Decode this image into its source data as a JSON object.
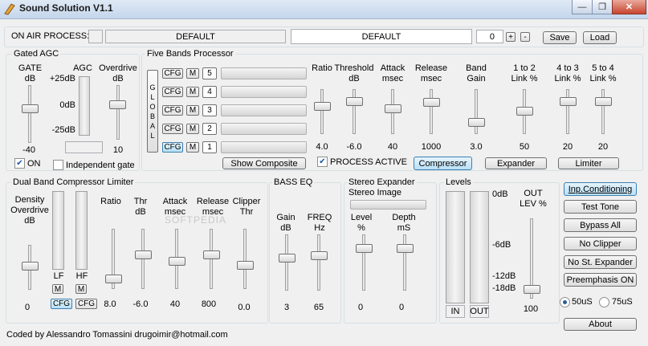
{
  "window": {
    "title": "Sound Solution V1.1",
    "minimize_icon": "—",
    "restore_icon": "❐",
    "close_icon": "✕"
  },
  "onair": {
    "label": "ON AIR PROCESS:",
    "left_preset": "DEFAULT",
    "right_preset": "DEFAULT",
    "preset_number": "0",
    "plus": "+",
    "minus": "-",
    "save": "Save",
    "load": "Load"
  },
  "agc": {
    "title": "Gated AGC",
    "gate_label": "GATE dB",
    "agc_label": "AGC",
    "overdrive_label": "Overdrive\ndB",
    "scale_top": "+25dB",
    "scale_mid": "0dB",
    "scale_bot": "-25dB",
    "gate_value": "-40",
    "overdrive_value": "10",
    "on_label": "ON",
    "on_checked": true,
    "indep_label": "Independent gate",
    "indep_checked": false
  },
  "five": {
    "title": "Five Bands Processor",
    "global": "G\nL\nO\nB\nA\nL",
    "cfg": "CFG",
    "m": "M",
    "bands": [
      "5",
      "4",
      "3",
      "2",
      "1"
    ],
    "cols": [
      {
        "label": "Ratio",
        "value": "4.0"
      },
      {
        "label": "Threshold\ndB",
        "value": "-6.0"
      },
      {
        "label": "Attack\nmsec",
        "value": "40"
      },
      {
        "label": "Release\nmsec",
        "value": "1000"
      },
      {
        "label": "Band\nGain",
        "value": "3.0"
      },
      {
        "label": "1 to 2\nLink %",
        "value": "50"
      },
      {
        "label": "4 to 3\nLink %",
        "value": "20"
      },
      {
        "label": "5 to 4\nLink %",
        "value": "20"
      }
    ],
    "show_composite": "Show Composite",
    "process_active": "PROCESS ACTIVE",
    "process_checked": true,
    "compressor": "Compressor",
    "expander": "Expander",
    "limiter": "Limiter"
  },
  "dual": {
    "title": "Dual Band Compressor Limiter",
    "density_label": "Density\nOverdrive\ndB",
    "ratio_label": "Ratio",
    "thr_label": "Thr\ndB",
    "attack_label": "Attack\nmsec",
    "release_label": "Release\nmsec",
    "clipper_label": "Clipper\nThr",
    "lf": "LF",
    "hf": "HF",
    "m": "M",
    "cfg": "CFG",
    "density_value": "0",
    "ratio_value": "8.0",
    "thr_value": "-6.0",
    "attack_value": "40",
    "release_value": "800",
    "clipper_value": "0.0"
  },
  "bass": {
    "title": "BASS EQ",
    "gain_label": "Gain\ndB",
    "freq_label": "FREQ\nHz",
    "gain_value": "3",
    "freq_value": "65"
  },
  "stereo": {
    "title": "Stereo Expander",
    "image_label": "Stereo Image",
    "level_label": "Level\n%",
    "depth_label": "Depth\nmS",
    "level_value": "0",
    "depth_value": "0"
  },
  "levels": {
    "title": "Levels",
    "s0": "0dB",
    "s6": "-6dB",
    "s12": "-12dB",
    "s18": "-18dB",
    "in": "IN",
    "out": "OUT",
    "outlev_label": "OUT\nLEV %",
    "outlev_value": "100"
  },
  "right": {
    "buttons": [
      "Inp.Conditioning",
      "Test Tone",
      "Bypass All",
      "No Clipper",
      "No St. Expander",
      "Preemphasis ON"
    ],
    "r50": "50uS",
    "r75": "75uS",
    "about": "About"
  },
  "footer": {
    "credit": "Coded by Alessandro Tomassini drugoimir@hotmail.com"
  },
  "watermark": "SOFTPEDIA"
}
